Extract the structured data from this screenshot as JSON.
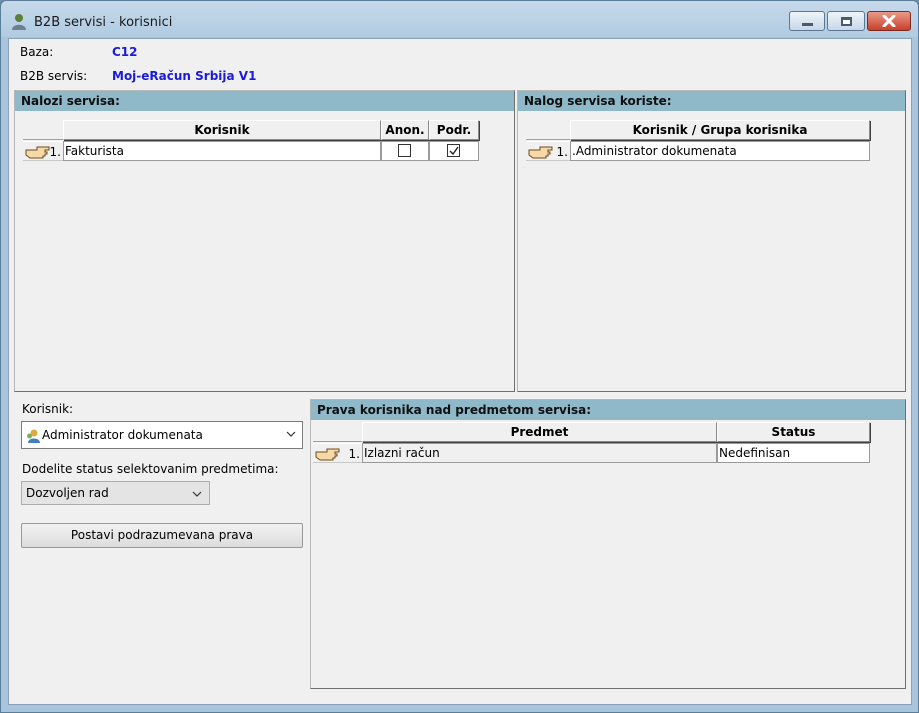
{
  "window": {
    "title": "B2B servisi - korisnici"
  },
  "info": {
    "baza_label": "Baza:",
    "baza_value": "C12",
    "servis_label": "B2B servis:",
    "servis_value": "Moj-eRačun Srbija V1"
  },
  "nalozi_panel": {
    "title": "Nalozi servisa:",
    "columns": [
      "Korisnik",
      "Anon.",
      "Podr."
    ],
    "rows": [
      {
        "num": "1.",
        "korisnik": "Fakturista",
        "anon": false,
        "podr": true
      }
    ]
  },
  "nalog_koriste_panel": {
    "title": "Nalog servisa koriste:",
    "columns": [
      "Korisnik / Grupa korisnika"
    ],
    "rows": [
      {
        "num": "1.",
        "value": ".Administrator dokumenata"
      }
    ]
  },
  "left_controls": {
    "korisnik_label": "Korisnik:",
    "korisnik_value": "Administrator dokumenata",
    "status_label": "Dodelite status selektovanim predmetima:",
    "status_value": "Dozvoljen rad",
    "button_label": "Postavi podrazumevana prava"
  },
  "prava_panel": {
    "title": "Prava korisnika nad predmetom servisa:",
    "columns": [
      "Predmet",
      "Status"
    ],
    "rows": [
      {
        "num": "1.",
        "predmet": "Izlazni račun",
        "status": "Nedefinisan"
      }
    ]
  },
  "icons": {
    "app": "users-icon",
    "row_pointer": "pointing-hand-icon",
    "checkbox_checked": "check-icon"
  },
  "colors": {
    "panel_header": "#8fb8c8",
    "value_text": "#1a1adc",
    "close_button": "#c8412d"
  }
}
